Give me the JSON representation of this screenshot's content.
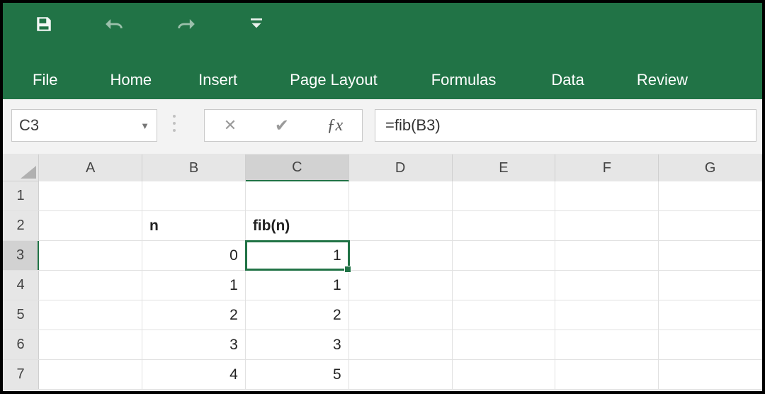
{
  "ribbon": {
    "tabs": [
      "File",
      "Home",
      "Insert",
      "Page Layout",
      "Formulas",
      "Data",
      "Review"
    ]
  },
  "namebox": {
    "value": "C3"
  },
  "formula_bar": {
    "value": "=fib(B3)"
  },
  "columns": [
    "A",
    "B",
    "C",
    "D",
    "E",
    "F",
    "G"
  ],
  "selected_column": "C",
  "selected_row": 3,
  "rows": [
    {
      "num": 1,
      "cells": {
        "A": "",
        "B": "",
        "C": ""
      }
    },
    {
      "num": 2,
      "cells": {
        "A": "",
        "B": "n",
        "C": "fib(n)"
      },
      "bold": [
        "B",
        "C"
      ],
      "align": {
        "B": "left",
        "C": "left"
      }
    },
    {
      "num": 3,
      "cells": {
        "A": "",
        "B": "0",
        "C": "1"
      },
      "align": {
        "B": "right",
        "C": "right"
      }
    },
    {
      "num": 4,
      "cells": {
        "A": "",
        "B": "1",
        "C": "1"
      },
      "align": {
        "B": "right",
        "C": "right"
      }
    },
    {
      "num": 5,
      "cells": {
        "A": "",
        "B": "2",
        "C": "2"
      },
      "align": {
        "B": "right",
        "C": "right"
      }
    },
    {
      "num": 6,
      "cells": {
        "A": "",
        "B": "3",
        "C": "3"
      },
      "align": {
        "B": "right",
        "C": "right"
      }
    },
    {
      "num": 7,
      "cells": {
        "A": "",
        "B": "4",
        "C": "5"
      },
      "align": {
        "B": "right",
        "C": "right"
      }
    }
  ]
}
